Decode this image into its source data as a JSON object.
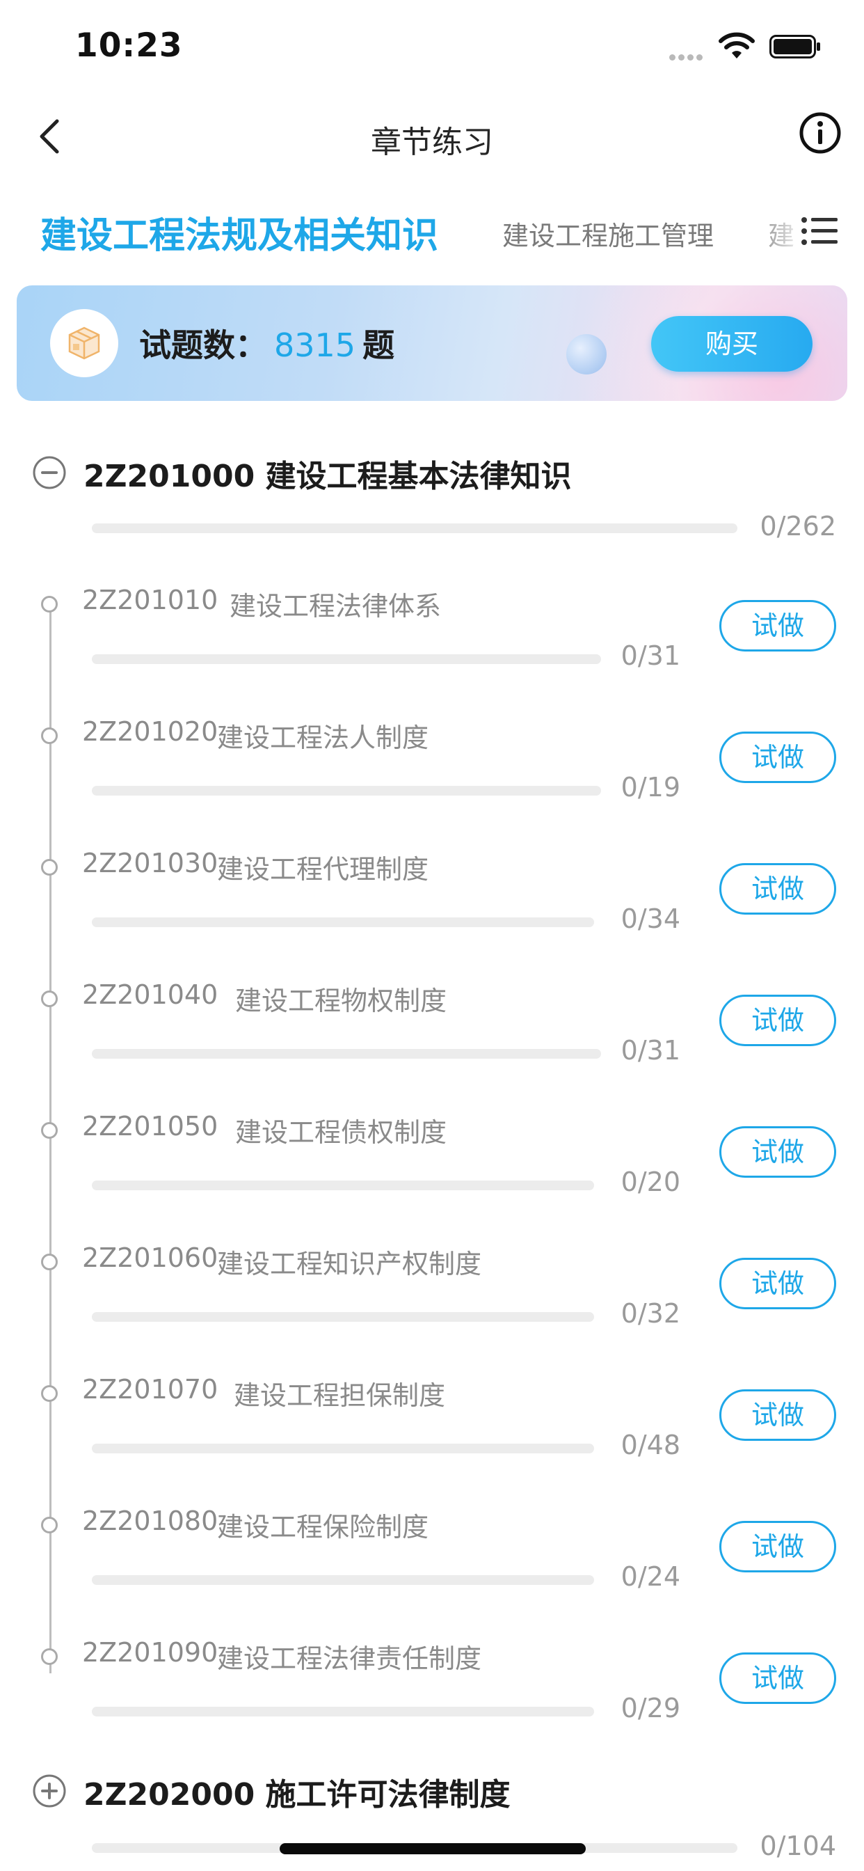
{
  "status_bar": {
    "time": "10:23"
  },
  "nav": {
    "title": "章节练习"
  },
  "tabs": [
    {
      "label": "建设工程法规及相关知识",
      "active": true
    },
    {
      "label": "建设工程施工管理",
      "active": false
    },
    {
      "label": "建",
      "active": false
    }
  ],
  "banner": {
    "label": "试题数：",
    "count": "8315",
    "unit": "题",
    "buy_label": "购买"
  },
  "chapters": [
    {
      "title": "2Z201000 建设工程基本法律知识",
      "expanded": true,
      "progress": "0/262",
      "items": [
        {
          "code": "2Z201010",
          "title": "建设工程法律体系",
          "progress": "0/31",
          "button": "试做"
        },
        {
          "code": "2Z201020",
          "title": "建设工程法人制度",
          "progress": "0/19",
          "button": "试做"
        },
        {
          "code": "2Z201030",
          "title": "建设工程代理制度",
          "progress": "0/34",
          "button": "试做"
        },
        {
          "code": "2Z201040",
          "title": "建设工程物权制度",
          "progress": "0/31",
          "button": "试做"
        },
        {
          "code": "2Z201050",
          "title": "建设工程债权制度",
          "progress": "0/20",
          "button": "试做"
        },
        {
          "code": "2Z201060",
          "title": "建设工程知识产权制度",
          "progress": "0/32",
          "button": "试做"
        },
        {
          "code": "2Z201070",
          "title": "建设工程担保制度",
          "progress": "0/48",
          "button": "试做"
        },
        {
          "code": "2Z201080",
          "title": "建设工程保险制度",
          "progress": "0/24",
          "button": "试做"
        },
        {
          "code": "2Z201090",
          "title": "建设工程法律责任制度",
          "progress": "0/29",
          "button": "试做"
        }
      ]
    },
    {
      "title": "2Z202000 施工许可法律制度",
      "expanded": false,
      "progress": "0/104"
    }
  ],
  "icons": {
    "back": "chevron-left-icon",
    "info": "info-circle-icon",
    "menu": "list-menu-icon",
    "banner": "package-box-icon",
    "collapse": "minus-circle-icon",
    "expand": "plus-circle-icon",
    "wifi": "wifi-icon",
    "battery": "battery-icon"
  },
  "colors": {
    "accent": "#1ea7e8",
    "text": "#1c1c1c",
    "muted": "#8a8a8a",
    "track": "#ececec"
  }
}
